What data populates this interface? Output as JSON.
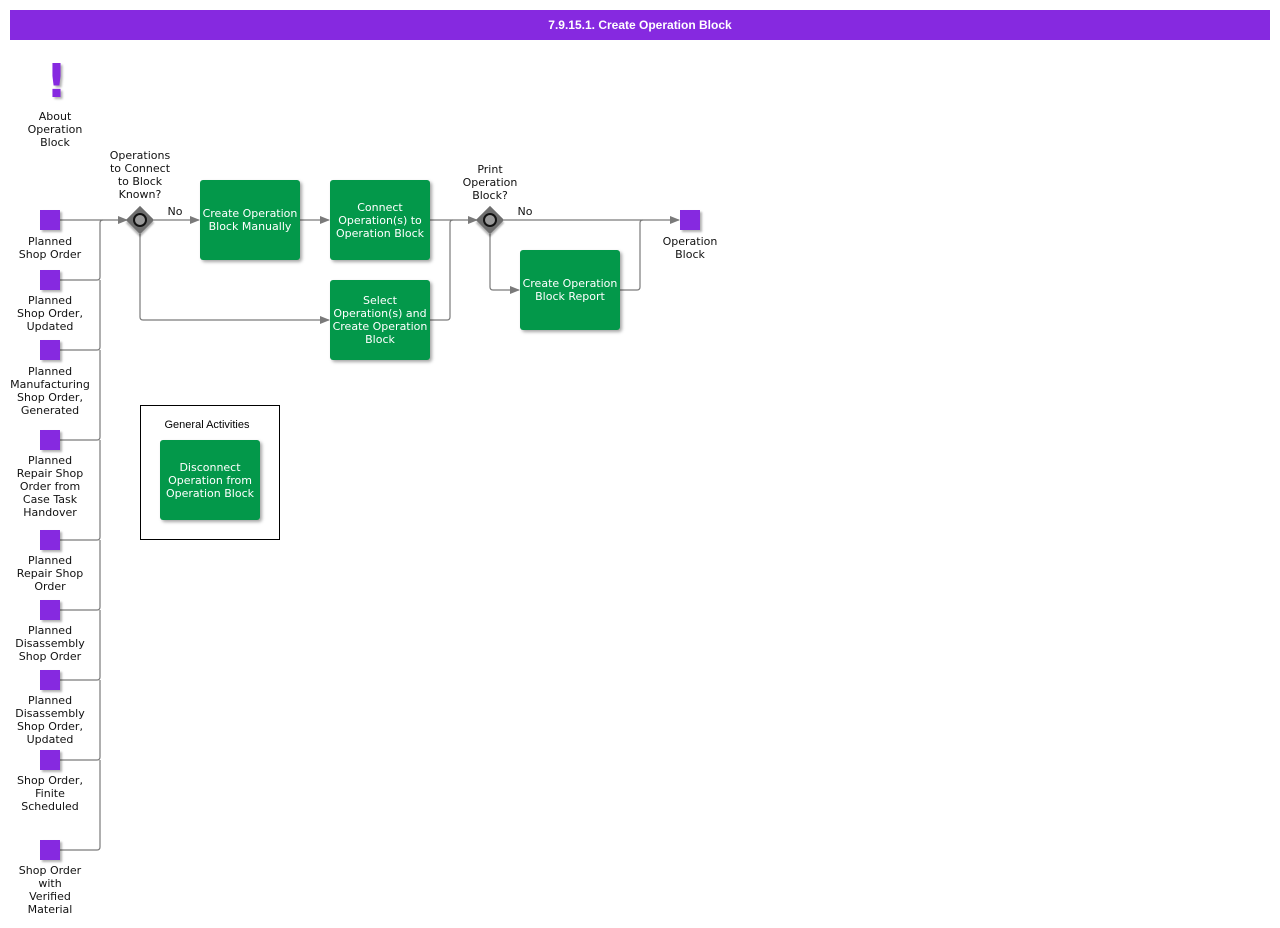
{
  "title": "7.9.15.1. Create Operation Block",
  "colors": {
    "title_bar": "#8629e0",
    "event": "#8629e0",
    "task": "#03984a",
    "gateway": "#6e6e6e",
    "connector": "#7a7a7a"
  },
  "about": {
    "icon": "exclamation-icon",
    "label": "About\nOperation\nBlock"
  },
  "start_events": [
    {
      "label": "Planned\nShop Order"
    },
    {
      "label": "Planned\nShop Order,\nUpdated"
    },
    {
      "label": "Planned\nManufacturing\nShop Order,\nGenerated"
    },
    {
      "label": "Planned\nRepair Shop\nOrder from\nCase Task\nHandover"
    },
    {
      "label": "Planned\nRepair Shop\nOrder"
    },
    {
      "label": "Planned\nDisassembly\nShop Order"
    },
    {
      "label": "Planned\nDisassembly\nShop Order,\nUpdated"
    },
    {
      "label": "Shop Order,\nFinite\nScheduled"
    },
    {
      "label": "Shop Order\nwith\nVerified\nMaterial"
    }
  ],
  "gateways": [
    {
      "label": "Operations\nto Connect\nto Block\nKnown?",
      "branch_label": "No"
    },
    {
      "label": "Print\nOperation\nBlock?",
      "branch_label": "No"
    }
  ],
  "tasks": {
    "create_manual": "Create Operation Block Manually",
    "connect_ops": "Connect Operation(s) to Operation Block",
    "select_ops": "Select Operation(s) and Create Operation Block",
    "create_report": "Create Operation Block Report",
    "disconnect": "Disconnect Operation from Operation Block"
  },
  "end_event": {
    "label": "Operation\nBlock"
  },
  "general_activities": {
    "title": "General Activities"
  }
}
